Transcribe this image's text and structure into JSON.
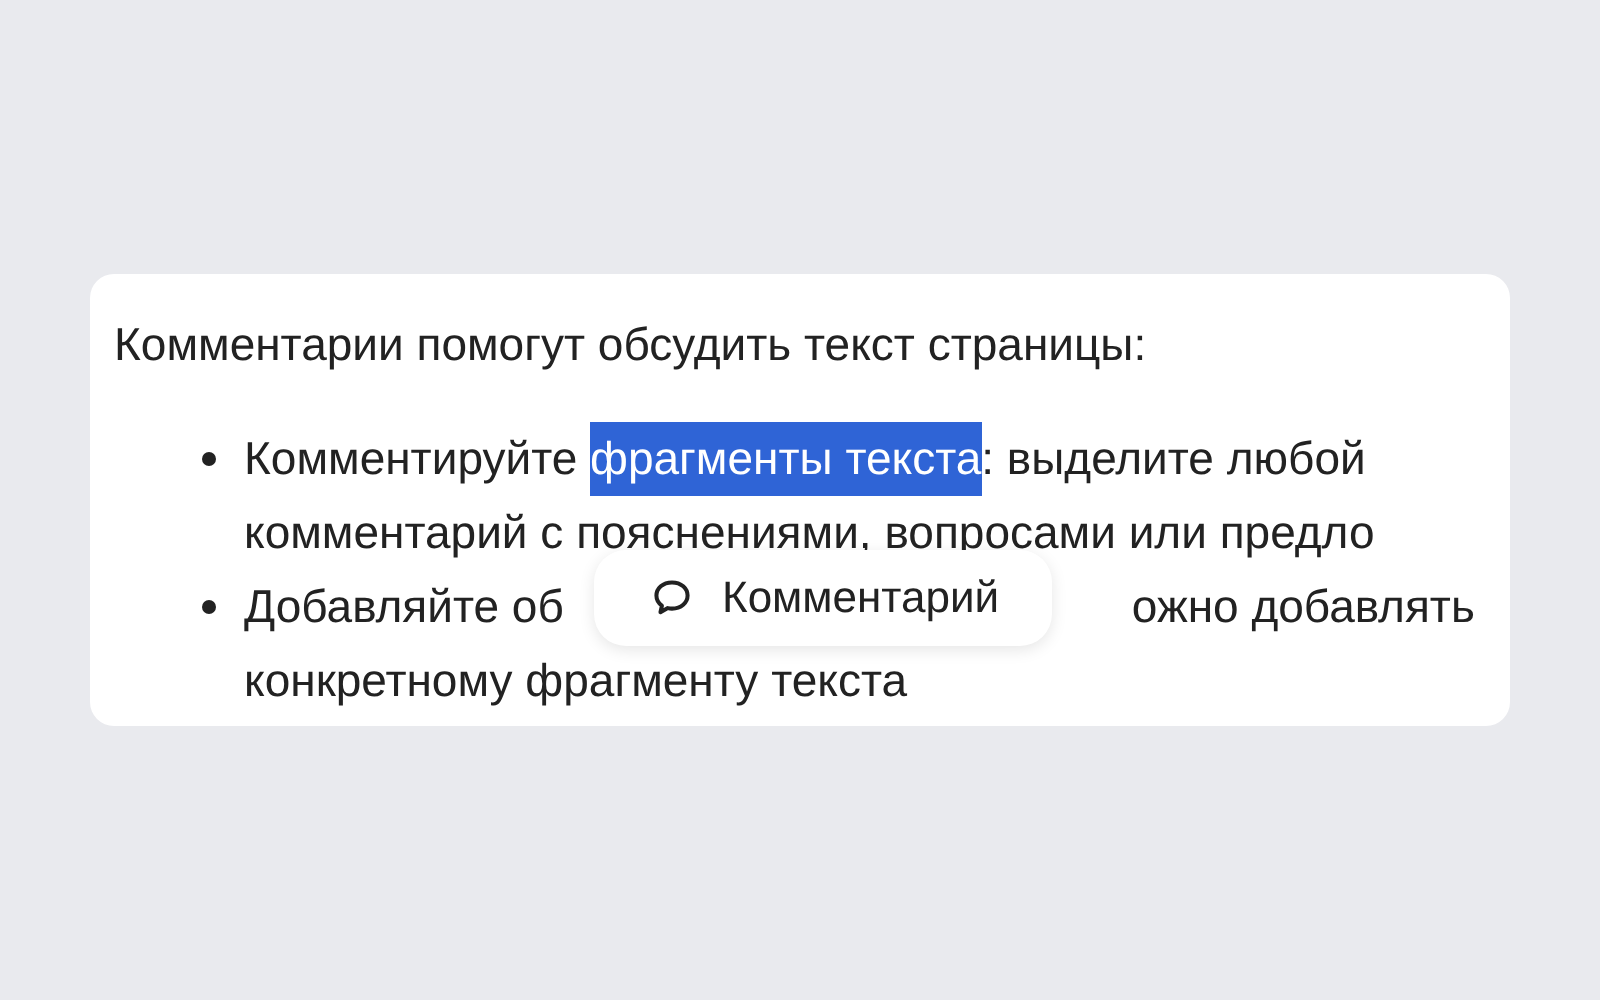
{
  "intro": "Комментарии помогут обсудить текст страницы:",
  "bullets": [
    {
      "lines": [
        [
          {
            "text": "Комментируйте ",
            "selected": false
          },
          {
            "text": "фрагменты текста",
            "selected": true
          },
          {
            "text": ": выделите любой",
            "selected": false
          }
        ],
        [
          {
            "text": "комментарий с пояснениями, вопросами или предло",
            "selected": false
          }
        ]
      ]
    },
    {
      "lines": [
        [
          {
            "text": "Добавляйте об",
            "selected": false
          },
          {
            "text": "ожно добавлять",
            "selected": false
          }
        ],
        [
          {
            "text": "конкретному фрагменту текста",
            "selected": false
          }
        ]
      ]
    }
  ],
  "popup": {
    "label": "Комментарий"
  }
}
